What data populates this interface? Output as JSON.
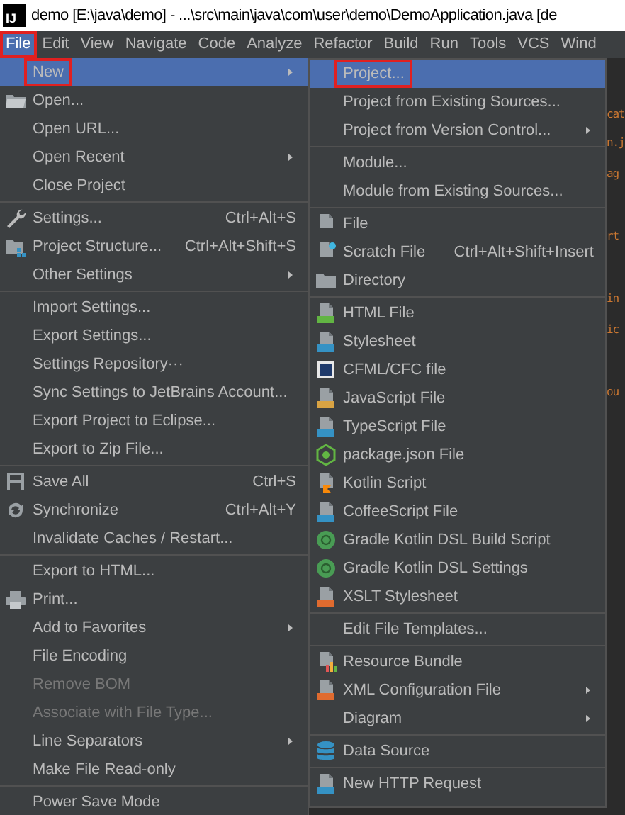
{
  "window": {
    "logo": "IJ",
    "title": "demo [E:\\java\\demo] - ...\\src\\main\\java\\com\\user\\demo\\DemoApplication.java [de"
  },
  "menu_bar": [
    {
      "label": "File",
      "selected": true,
      "annotated": true
    },
    {
      "label": "Edit",
      "selected": false,
      "annotated": false
    },
    {
      "label": "View",
      "selected": false,
      "annotated": false
    },
    {
      "label": "Navigate",
      "selected": false,
      "annotated": false
    },
    {
      "label": "Code",
      "selected": false,
      "annotated": false
    },
    {
      "label": "Analyze",
      "selected": false,
      "annotated": false
    },
    {
      "label": "Refactor",
      "selected": false,
      "annotated": false
    },
    {
      "label": "Build",
      "selected": false,
      "annotated": false
    },
    {
      "label": "Run",
      "selected": false,
      "annotated": false
    },
    {
      "label": "Tools",
      "selected": false,
      "annotated": false
    },
    {
      "label": "VCS",
      "selected": false,
      "annotated": false
    },
    {
      "label": "Wind",
      "selected": false,
      "annotated": false
    }
  ],
  "file_menu": [
    {
      "kind": "item",
      "label": "New",
      "submenu": true,
      "selected": true,
      "disabled": false,
      "annotated": true
    },
    {
      "kind": "item",
      "label": "Open...",
      "selected": false,
      "disabled": false,
      "annotated": false
    },
    {
      "kind": "item",
      "label": "Open URL...",
      "selected": false,
      "disabled": false,
      "annotated": false
    },
    {
      "kind": "item",
      "label": "Open Recent",
      "submenu": true,
      "selected": false,
      "disabled": false,
      "annotated": false
    },
    {
      "kind": "item",
      "label": "Close Project",
      "selected": false,
      "disabled": false,
      "annotated": false
    },
    {
      "kind": "separator"
    },
    {
      "kind": "item",
      "label": "Settings...",
      "shortcut": "Ctrl+Alt+S",
      "selected": false,
      "disabled": false,
      "annotated": false
    },
    {
      "kind": "item",
      "label": "Project Structure...",
      "shortcut": "Ctrl+Alt+Shift+S",
      "selected": false,
      "disabled": false,
      "annotated": false
    },
    {
      "kind": "item",
      "label": "Other Settings",
      "submenu": true,
      "selected": false,
      "disabled": false,
      "annotated": false
    },
    {
      "kind": "separator"
    },
    {
      "kind": "item",
      "label": "Import Settings...",
      "selected": false,
      "disabled": false,
      "annotated": false
    },
    {
      "kind": "item",
      "label": "Export Settings...",
      "selected": false,
      "disabled": false,
      "annotated": false
    },
    {
      "kind": "item",
      "label": "Settings Repository···",
      "selected": false,
      "disabled": false,
      "annotated": false
    },
    {
      "kind": "item",
      "label": "Sync Settings to JetBrains Account...",
      "selected": false,
      "disabled": false,
      "annotated": false
    },
    {
      "kind": "item",
      "label": "Export Project to Eclipse...",
      "selected": false,
      "disabled": false,
      "annotated": false
    },
    {
      "kind": "item",
      "label": "Export to Zip File...",
      "selected": false,
      "disabled": false,
      "annotated": false
    },
    {
      "kind": "separator"
    },
    {
      "kind": "item",
      "label": "Save All",
      "shortcut": "Ctrl+S",
      "selected": false,
      "disabled": false,
      "annotated": false
    },
    {
      "kind": "item",
      "label": "Synchronize",
      "shortcut": "Ctrl+Alt+Y",
      "selected": false,
      "disabled": false,
      "annotated": false
    },
    {
      "kind": "item",
      "label": "Invalidate Caches / Restart...",
      "selected": false,
      "disabled": false,
      "annotated": false
    },
    {
      "kind": "separator"
    },
    {
      "kind": "item",
      "label": "Export to HTML...",
      "selected": false,
      "disabled": false,
      "annotated": false
    },
    {
      "kind": "item",
      "label": "Print...",
      "selected": false,
      "disabled": false,
      "annotated": false
    },
    {
      "kind": "item",
      "label": "Add to Favorites",
      "submenu": true,
      "selected": false,
      "disabled": false,
      "annotated": false
    },
    {
      "kind": "item",
      "label": "File Encoding",
      "selected": false,
      "disabled": false,
      "annotated": false
    },
    {
      "kind": "item",
      "label": "Remove BOM",
      "selected": false,
      "disabled": true,
      "annotated": false
    },
    {
      "kind": "item",
      "label": "Associate with File Type...",
      "selected": false,
      "disabled": true,
      "annotated": false
    },
    {
      "kind": "item",
      "label": "Line Separators",
      "submenu": true,
      "selected": false,
      "disabled": false,
      "annotated": false
    },
    {
      "kind": "item",
      "label": "Make File Read-only",
      "selected": false,
      "disabled": false,
      "annotated": false
    },
    {
      "kind": "separator"
    },
    {
      "kind": "item",
      "label": "Power Save Mode",
      "selected": false,
      "disabled": false,
      "annotated": false
    }
  ],
  "new_submenu": [
    {
      "kind": "item",
      "label": "Project...",
      "selected": true,
      "annotated": true
    },
    {
      "kind": "item",
      "label": "Project from Existing Sources...",
      "selected": false,
      "annotated": false
    },
    {
      "kind": "item",
      "label": "Project from Version Control...",
      "submenu": true,
      "selected": false,
      "annotated": false
    },
    {
      "kind": "separator"
    },
    {
      "kind": "item",
      "label": "Module...",
      "selected": false,
      "annotated": false
    },
    {
      "kind": "item",
      "label": "Module from Existing Sources...",
      "selected": false,
      "annotated": false
    },
    {
      "kind": "separator"
    },
    {
      "kind": "item",
      "label": "File",
      "selected": false,
      "annotated": false
    },
    {
      "kind": "item",
      "label": "Scratch File",
      "shortcut": "Ctrl+Alt+Shift+Insert",
      "selected": false,
      "annotated": false
    },
    {
      "kind": "item",
      "label": "Directory",
      "selected": false,
      "annotated": false
    },
    {
      "kind": "separator"
    },
    {
      "kind": "item",
      "label": "HTML File",
      "selected": false,
      "annotated": false
    },
    {
      "kind": "item",
      "label": "Stylesheet",
      "selected": false,
      "annotated": false
    },
    {
      "kind": "item",
      "label": "CFML/CFC file",
      "selected": false,
      "annotated": false
    },
    {
      "kind": "item",
      "label": "JavaScript File",
      "selected": false,
      "annotated": false
    },
    {
      "kind": "item",
      "label": "TypeScript File",
      "selected": false,
      "annotated": false
    },
    {
      "kind": "item",
      "label": "package.json File",
      "selected": false,
      "annotated": false
    },
    {
      "kind": "item",
      "label": "Kotlin Script",
      "selected": false,
      "annotated": false
    },
    {
      "kind": "item",
      "label": "CoffeeScript File",
      "selected": false,
      "annotated": false
    },
    {
      "kind": "item",
      "label": "Gradle Kotlin DSL Build Script",
      "selected": false,
      "annotated": false
    },
    {
      "kind": "item",
      "label": "Gradle Kotlin DSL Settings",
      "selected": false,
      "annotated": false
    },
    {
      "kind": "item",
      "label": "XSLT Stylesheet",
      "selected": false,
      "annotated": false
    },
    {
      "kind": "separator"
    },
    {
      "kind": "item",
      "label": "Edit File Templates...",
      "selected": false,
      "annotated": false
    },
    {
      "kind": "separator"
    },
    {
      "kind": "item",
      "label": "Resource Bundle",
      "selected": false,
      "annotated": false
    },
    {
      "kind": "item",
      "label": "XML Configuration File",
      "submenu": true,
      "selected": false,
      "annotated": false
    },
    {
      "kind": "item",
      "label": "Diagram",
      "submenu": true,
      "selected": false,
      "annotated": false
    },
    {
      "kind": "separator"
    },
    {
      "kind": "item",
      "label": "Data Source",
      "selected": false,
      "annotated": false
    },
    {
      "kind": "separator"
    },
    {
      "kind": "item",
      "label": "New HTTP Request",
      "selected": false,
      "annotated": false
    }
  ],
  "editor_fragments": [
    "cat",
    "n.j",
    "ag",
    "rt",
    "in",
    "ic",
    "ou"
  ]
}
